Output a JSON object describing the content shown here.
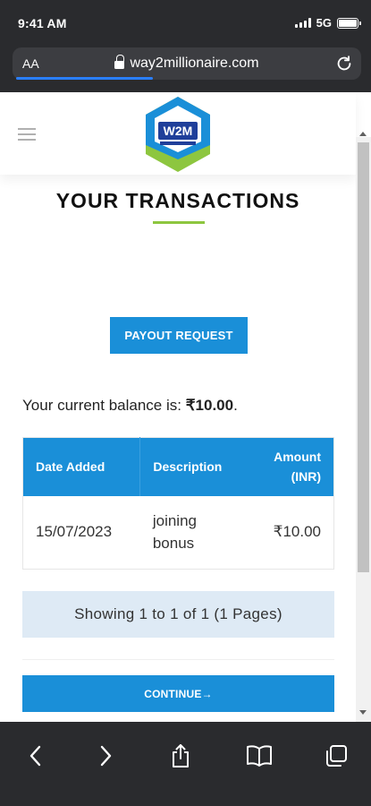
{
  "status_bar": {
    "time": "9:41 AM",
    "network": "5G"
  },
  "browser": {
    "text_size_label": "AA",
    "url": "way2millionaire.com",
    "load_progress": 0.4
  },
  "page": {
    "logo_text": "W2M",
    "title": "YOUR TRANSACTIONS",
    "payout_button_label": "PAYOUT REQUEST",
    "balance_label": "Your current balance is:",
    "balance_value": "₹10.00",
    "balance_suffix": ".",
    "table": {
      "headers": {
        "date": "Date Added",
        "description": "Description",
        "amount_line1": "Amount",
        "amount_line2": "(INR)"
      },
      "rows": [
        {
          "date": "15/07/2023",
          "description_line1": "joining",
          "description_line2": "bonus",
          "amount": "₹10.00"
        }
      ]
    },
    "pagination_text": "Showing 1 to 1 of 1 (1 Pages)",
    "continue_button_label": "CONTINUE→"
  },
  "colors": {
    "primary": "#1a8fd8",
    "accent_green": "#8dc63f",
    "pagination_bg": "#deeaf5",
    "chrome": "#2a2b2e"
  }
}
